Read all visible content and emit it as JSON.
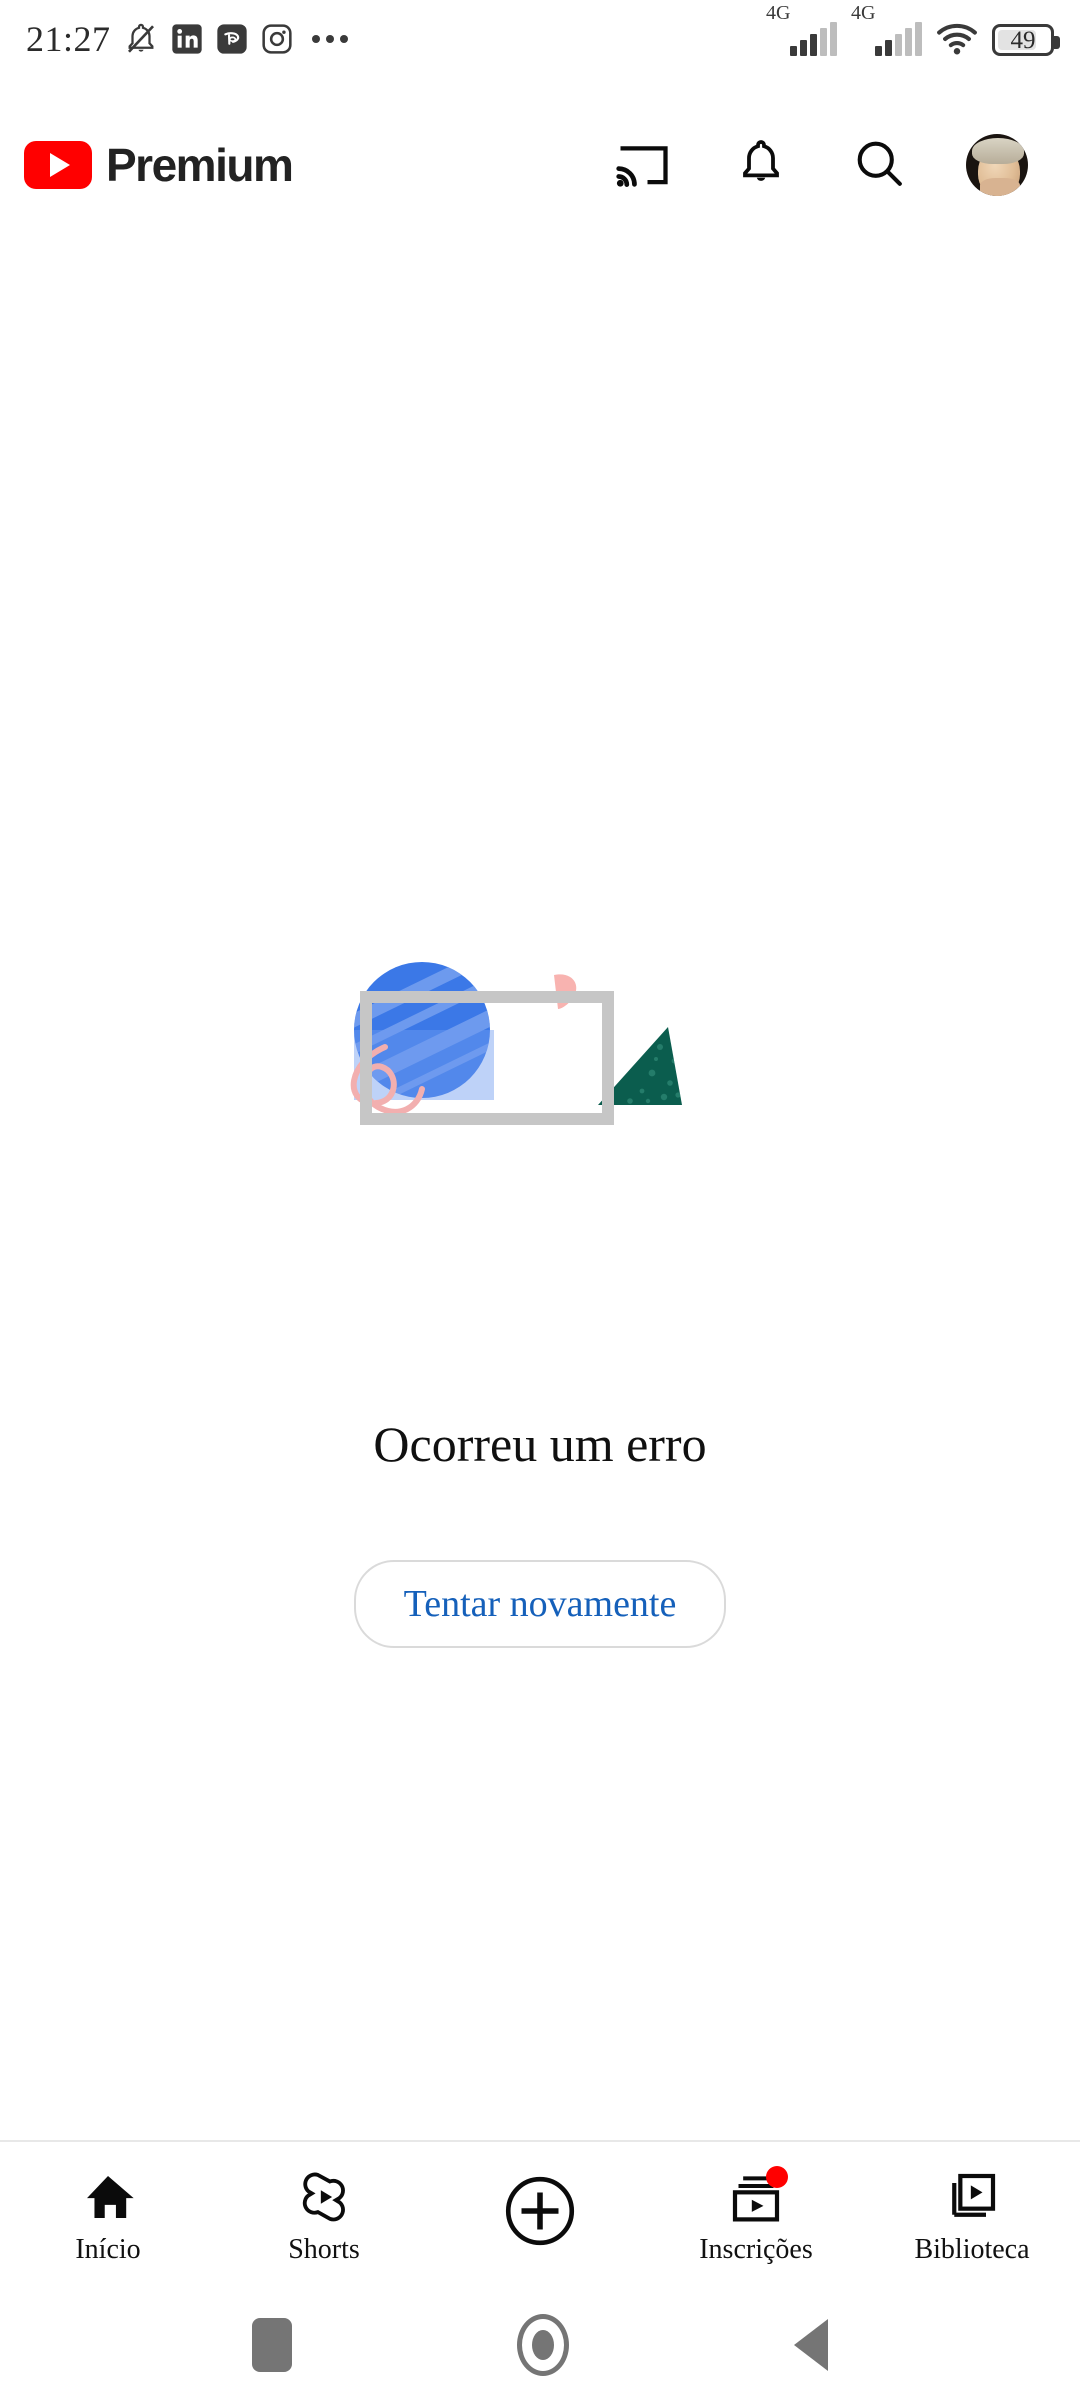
{
  "status_bar": {
    "time": "21:27",
    "left_icons": [
      "bell-muted-icon",
      "linkedin-icon",
      "disneyplus-icon",
      "instagram-icon",
      "overflow-dots-icon"
    ],
    "network_1_label": "4G",
    "network_2_label": "4G",
    "wifi": "wifi-icon",
    "battery_level": "49"
  },
  "app_header": {
    "brand_name": "Premium",
    "logo": "youtube-logo",
    "actions": [
      {
        "name": "cast-icon",
        "label": "Transmitir"
      },
      {
        "name": "bell-icon",
        "label": "Notificações"
      },
      {
        "name": "search-icon",
        "label": "Pesquisar"
      },
      {
        "name": "avatar",
        "label": "Conta"
      }
    ]
  },
  "error_state": {
    "illustration": "broken-media-illustration",
    "title": "Ocorreu um erro",
    "retry_label": "Tentar novamente"
  },
  "bottom_nav": {
    "items": [
      {
        "label": "Início",
        "icon": "home-icon",
        "active": true,
        "badge": false
      },
      {
        "label": "Shorts",
        "icon": "shorts-icon",
        "active": false,
        "badge": false
      },
      {
        "label": "",
        "icon": "create-plus-icon",
        "active": false,
        "badge": false
      },
      {
        "label": "Inscrições",
        "icon": "subscriptions-icon",
        "active": false,
        "badge": true
      },
      {
        "label": "Biblioteca",
        "icon": "library-icon",
        "active": false,
        "badge": false
      }
    ]
  },
  "system_nav": {
    "recent": "recent-apps-button",
    "home": "home-button",
    "back": "back-button"
  },
  "colors": {
    "youtube_red": "#FF0000",
    "link_blue": "#1560ba",
    "illus_blue": "#3b78e7",
    "illus_green": "#0b5d4e",
    "illus_pink": "#f5b0b0",
    "illus_grey": "#c6c6c6"
  }
}
